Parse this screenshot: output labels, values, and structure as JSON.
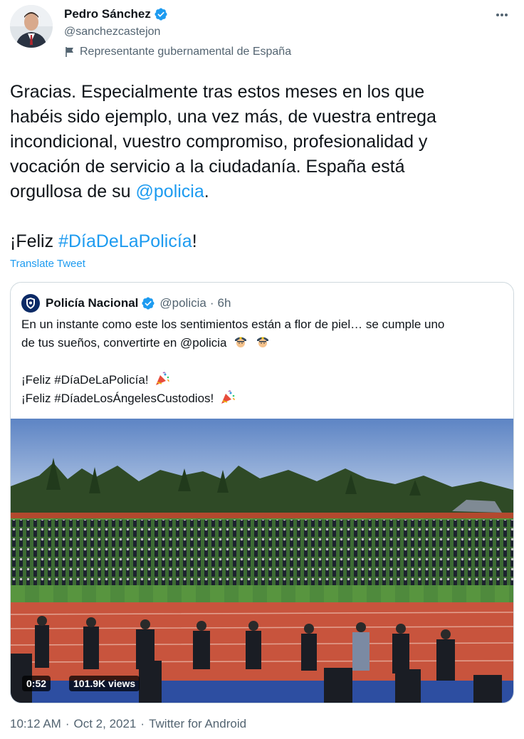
{
  "author": {
    "name": "Pedro Sánchez",
    "handle": "@sanchezcastejon",
    "label": "Representante gubernamental de España"
  },
  "tweet": {
    "line1": "Gracias. Especialmente tras estos meses en los que",
    "line2": "habéis sido ejemplo, una vez más, de vuestra entrega",
    "line3": "incondicional, vuestro compromiso, profesionalidad y",
    "line4": "vocación de servicio a la ciudadanía. España está",
    "line5_prefix": "orgullosa de su ",
    "mention": "@policia",
    "line5_suffix": ".",
    "feliz_prefix": "¡Feliz ",
    "hashtag": "#DíaDeLaPolicía",
    "feliz_suffix": "!",
    "translate": "Translate Tweet"
  },
  "quote": {
    "name": "Policía Nacional",
    "handle": "@policia",
    "sep": "·",
    "time": "6h",
    "line1": "En un instante como este los sentimientos están a flor de piel… se cumple uno",
    "line2": "de tus sueños, convertirte en @policia",
    "line3": "¡Feliz #DíaDeLaPolicía!",
    "line4": "¡Feliz #DíadeLosÁngelesCustodios!",
    "media": {
      "duration": "0:52",
      "views": "101.9K views"
    }
  },
  "footer": {
    "time": "10:12 AM",
    "date": "Oct 2, 2021",
    "source": "Twitter for Android",
    "sep": "·"
  },
  "colors": {
    "accent": "#1d9bf0",
    "text": "#0f1419",
    "secondary": "#536471",
    "border": "#cfd9de"
  }
}
